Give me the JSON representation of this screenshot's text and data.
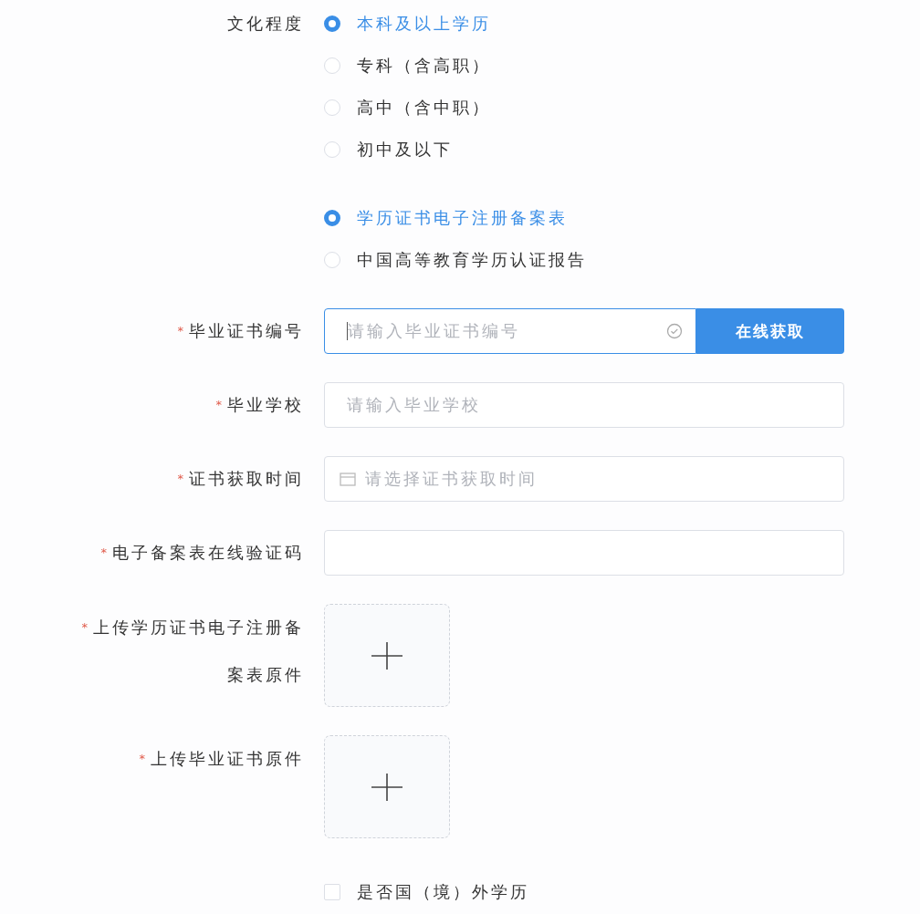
{
  "education": {
    "label": "文化程度",
    "options": [
      {
        "label": "本科及以上学历",
        "selected": true
      },
      {
        "label": "专科（含高职）",
        "selected": false
      },
      {
        "label": "高中（含中职）",
        "selected": false
      },
      {
        "label": "初中及以下",
        "selected": false
      }
    ]
  },
  "document_type": {
    "options": [
      {
        "label": "学历证书电子注册备案表",
        "selected": true
      },
      {
        "label": "中国高等教育学历认证报告",
        "selected": false
      }
    ]
  },
  "fields": [
    {
      "kind": "input",
      "mark": "*",
      "label": "毕业证书编号",
      "placeholder": "请输入毕业证书编号",
      "focused": true,
      "button": "在线获取"
    },
    {
      "kind": "input",
      "mark": "*",
      "label": "毕业学校",
      "placeholder": "请输入毕业学校",
      "focused": false
    },
    {
      "kind": "date",
      "mark": "*",
      "label": "证书获取时间",
      "placeholder": "请选择证书获取时间",
      "focused": false
    },
    {
      "kind": "input",
      "mark": "*",
      "label": "电子备案表在线验证码",
      "focused": false
    }
  ],
  "uploads": [
    {
      "mark": "*",
      "label": "上传学历证书电子注册备案表原件"
    },
    {
      "mark": "*",
      "label": "上传毕业证书原件"
    }
  ],
  "overseas": {
    "label": "是否国（境）外学历",
    "checked": false
  }
}
